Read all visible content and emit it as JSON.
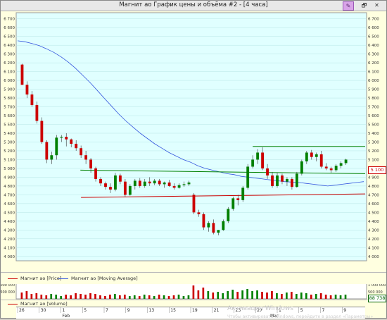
{
  "window": {
    "title": "Магнит ао График цены и объёма #2 - [4 часа]",
    "buttons": [
      "✎",
      "🗗",
      "✕"
    ]
  },
  "legend": {
    "price_label": "Магнит ао [Price]",
    "ma_label": "Магнит ао [Moving Average]",
    "volume_label": "Магнит ао [Volume]"
  },
  "price_tag": "5 100",
  "volume_tag": "88 738",
  "watermark": {
    "line1": "Активация Windows",
    "line2": "Чтобы активировать Windows, перейдите в раздел «Параметры»"
  },
  "colors": {
    "bg": "#e0ffff",
    "up": "#008000",
    "down": "#cc0000",
    "ma": "#3355dd",
    "support": "#cc0000",
    "resistance": "#008000"
  },
  "chart_data": {
    "type": "candlestick",
    "y_ticks": [
      4000,
      4100,
      4200,
      4300,
      4400,
      4500,
      4600,
      4700,
      4800,
      4900,
      5000,
      5100,
      5200,
      5300,
      5400,
      5500,
      5600,
      5700,
      5800,
      5900,
      6000,
      6100,
      6200,
      6300,
      6400,
      6500,
      6600,
      6700
    ],
    "ylim": [
      3950,
      6770
    ],
    "volume_ticks": [
      "1 000 000",
      "500 000"
    ],
    "date_ticks": [
      "26",
      "30",
      "1",
      "5",
      "7",
      "9",
      "13",
      "15",
      "19",
      "21",
      "23",
      "27",
      "1",
      "5",
      "7",
      "9"
    ],
    "month_labels": [
      "Feb",
      "Mar"
    ],
    "ohlc": [
      [
        6180,
        6190,
        5950,
        5950
      ],
      [
        5950,
        5990,
        5800,
        5840
      ],
      [
        5840,
        5880,
        5700,
        5720
      ],
      [
        5720,
        5760,
        5510,
        5540
      ],
      [
        5540,
        5580,
        5280,
        5300
      ],
      [
        5300,
        5320,
        5060,
        5100
      ],
      [
        5100,
        5190,
        5050,
        5150
      ],
      [
        5150,
        5380,
        5100,
        5350
      ],
      [
        5350,
        5380,
        5300,
        5360
      ],
      [
        5360,
        5400,
        5250,
        5330
      ],
      [
        5330,
        5340,
        5240,
        5280
      ],
      [
        5280,
        5320,
        5200,
        5230
      ],
      [
        5230,
        5260,
        5120,
        5150
      ],
      [
        5150,
        5200,
        5050,
        5100
      ],
      [
        5100,
        5120,
        4950,
        5000
      ],
      [
        5000,
        5020,
        4850,
        4880
      ],
      [
        4880,
        4900,
        4800,
        4830
      ],
      [
        4830,
        4850,
        4760,
        4790
      ],
      [
        4790,
        4830,
        4720,
        4760
      ],
      [
        4760,
        4950,
        4740,
        4920
      ],
      [
        4920,
        4940,
        4820,
        4850
      ],
      [
        4850,
        4880,
        4680,
        4700
      ],
      [
        4700,
        4820,
        4690,
        4800
      ],
      [
        4800,
        4880,
        4760,
        4860
      ],
      [
        4860,
        4890,
        4780,
        4800
      ],
      [
        4800,
        4880,
        4780,
        4850
      ],
      [
        4850,
        4900,
        4800,
        4830
      ],
      [
        4830,
        4880,
        4810,
        4860
      ],
      [
        4860,
        4880,
        4800,
        4820
      ],
      [
        4820,
        4850,
        4780,
        4840
      ],
      [
        4840,
        4870,
        4790,
        4800
      ],
      [
        4800,
        4830,
        4760,
        4780
      ],
      [
        4780,
        4830,
        4770,
        4810
      ],
      [
        4810,
        4850,
        4790,
        4820
      ],
      [
        4820,
        4860,
        4800,
        4840
      ],
      [
        4700,
        4720,
        4480,
        4500
      ],
      [
        4500,
        4530,
        4450,
        4480
      ],
      [
        4480,
        4500,
        4300,
        4330
      ],
      [
        4330,
        4400,
        4280,
        4380
      ],
      [
        4380,
        4420,
        4250,
        4270
      ],
      [
        4270,
        4300,
        4240,
        4300
      ],
      [
        4300,
        4420,
        4290,
        4400
      ],
      [
        4400,
        4560,
        4380,
        4540
      ],
      [
        4540,
        4680,
        4520,
        4660
      ],
      [
        4660,
        4700,
        4580,
        4640
      ],
      [
        4640,
        4800,
        4620,
        4780
      ],
      [
        4780,
        5050,
        4760,
        5020
      ],
      [
        5020,
        5150,
        5000,
        5100
      ],
      [
        5100,
        5220,
        5050,
        5180
      ],
      [
        5180,
        5240,
        4980,
        5000
      ],
      [
        5000,
        5050,
        4880,
        4920
      ],
      [
        4920,
        4960,
        4780,
        4800
      ],
      [
        4800,
        4950,
        4780,
        4920
      ],
      [
        4920,
        4940,
        4820,
        4850
      ],
      [
        4850,
        4900,
        4800,
        4880
      ],
      [
        4880,
        4900,
        4760,
        4790
      ],
      [
        4790,
        4960,
        4780,
        4940
      ],
      [
        4940,
        5100,
        4920,
        5080
      ],
      [
        5080,
        5200,
        5050,
        5180
      ],
      [
        5180,
        5210,
        5100,
        5130
      ],
      [
        5130,
        5180,
        5080,
        5160
      ],
      [
        5160,
        5200,
        5000,
        5020
      ],
      [
        5020,
        5060,
        4980,
        5000
      ],
      [
        5000,
        5020,
        4950,
        4980
      ],
      [
        4980,
        5050,
        4960,
        5030
      ],
      [
        5030,
        5080,
        5000,
        5060
      ],
      [
        5060,
        5110,
        5040,
        5100
      ]
    ],
    "moving_average": [
      6450,
      6440,
      6420,
      6395,
      6360,
      6320,
      6270,
      6210,
      6140,
      6060,
      5980,
      5890,
      5800,
      5710,
      5620,
      5540,
      5470,
      5400,
      5340,
      5280,
      5230,
      5180,
      5140,
      5100,
      5070,
      5030,
      5000,
      4980,
      4960,
      4940,
      4930,
      4910,
      4900,
      4890,
      4880,
      4870,
      4860,
      4850,
      4845,
      4840,
      4830,
      4820,
      4810,
      4800,
      4810,
      4820,
      4830,
      4840,
      4850
    ],
    "support_line": [
      4670,
      4710
    ],
    "resistance_upper": [
      5250,
      5250
    ],
    "resistance_lower": [
      4980,
      4940
    ],
    "volumes": [
      0.45,
      0.55,
      0.35,
      0.4,
      0.3,
      0.25,
      0.35,
      0.3,
      0.2,
      0.3,
      0.25,
      0.4,
      0.35,
      0.3,
      0.4,
      0.35,
      0.25,
      0.2,
      0.3,
      0.35,
      0.25,
      0.3,
      0.2,
      0.25,
      0.2,
      0.3,
      0.25,
      0.2,
      0.3,
      0.25,
      0.2,
      0.25,
      0.3,
      0.2,
      0.25,
      0.95,
      0.6,
      0.8,
      0.55,
      0.45,
      0.5,
      0.4,
      0.55,
      0.65,
      0.5,
      0.6,
      0.7,
      0.55,
      0.6,
      0.5,
      0.45,
      0.55,
      0.4,
      0.35,
      0.45,
      0.5,
      0.35,
      0.45,
      0.4,
      0.3,
      0.35,
      0.4,
      0.3,
      0.25,
      0.3,
      0.25,
      0.3
    ]
  }
}
